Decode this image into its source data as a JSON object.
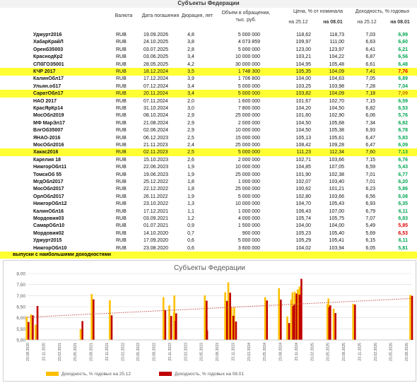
{
  "header": {
    "title": "Субъекты Федерации",
    "col_currency": "Валюта",
    "col_maturity": "Дата погашения",
    "col_duration": "Дюрация, лет",
    "col_volume_1": "Объем в обращении,",
    "col_volume_2": "тыс. руб.",
    "col_price": "Цена, % от номинала",
    "col_price_d1": "на 25.12",
    "col_price_d2": "на 08.01",
    "col_yield": "Доходность, % годовых",
    "col_yield_d1": "на 25.12",
    "col_yield_d2": "на 08.01"
  },
  "colors": {
    "up": "#00a651",
    "down": "#e00000",
    "neutral": "#c07000",
    "highlight": "#ffff33",
    "series1": "#ffc000",
    "series2": "#c00000",
    "trend": "#c0504d"
  },
  "rows": [
    {
      "name": "Удмурт2016",
      "currency": "RUB",
      "maturity": "19.09.2026",
      "duration": "4,8",
      "volume": "5 000 000",
      "price1": "118,62",
      "price2": "118,73",
      "yield1": "7,03",
      "yield2": "6,99",
      "dir": "up",
      "hl": false
    },
    {
      "name": "ХабарКрайЛ",
      "currency": "RUB",
      "maturity": "24.10.2025",
      "duration": "3,8",
      "volume": "4 073 859",
      "price1": "109,97",
      "price2": "111,00",
      "yield1": "6,63",
      "yield2": "6,60",
      "dir": "up",
      "hl": false
    },
    {
      "name": "ОренбЗ5003",
      "currency": "RUB",
      "maturity": "03.07.2025",
      "duration": "2,8",
      "volume": "5 000 000",
      "price1": "123,00",
      "price2": "123,97",
      "yield1": "6,41",
      "yield2": "6,21",
      "dir": "up",
      "hl": false
    },
    {
      "name": "КраснодКр2",
      "currency": "RUB",
      "maturity": "03.06.2025",
      "duration": "3,4",
      "volume": "10 000 000",
      "price1": "103,21",
      "price2": "104,22",
      "yield1": "6,87",
      "yield2": "6,56",
      "dir": "up",
      "hl": false
    },
    {
      "name": "СПбГОЗ5001",
      "currency": "RUB",
      "maturity": "28.05.2025",
      "duration": "4,2",
      "volume": "30 000 000",
      "price1": "104,95",
      "price2": "105,48",
      "yield1": "6,61",
      "yield2": "6,48",
      "dir": "up",
      "hl": false
    },
    {
      "name": "КЧР 2017",
      "currency": "RUB",
      "maturity": "18.12.2024",
      "duration": "3,5",
      "volume": "1 748 300",
      "price1": "105,35",
      "price2": "104,09",
      "yield1": "7,41",
      "yield2": "7,76",
      "dir": "down",
      "hl": true
    },
    {
      "name": "КалинОбл17",
      "currency": "RUB",
      "maturity": "17.12.2024",
      "duration": "3,9",
      "volume": "1 706 800",
      "price1": "104,00",
      "price2": "104,63",
      "yield1": "7,05",
      "yield2": "6,89",
      "dir": "up",
      "hl": false
    },
    {
      "name": "Ульян.об17",
      "currency": "RUB",
      "maturity": "07.12.2024",
      "duration": "3,4",
      "volume": "5 000 000",
      "price1": "103,25",
      "price2": "103,98",
      "yield1": "7,28",
      "yield2": "7,04",
      "dir": "up",
      "hl": false
    },
    {
      "name": "СаратОбл17",
      "currency": "RUB",
      "maturity": "20.11.2024",
      "duration": "3,4",
      "volume": "5 000 000",
      "price1": "103,82",
      "price2": "104,09",
      "yield1": "7,18",
      "yield2": "7,09",
      "dir": "neutral",
      "hl": true
    },
    {
      "name": "НАО 2017",
      "currency": "RUB",
      "maturity": "07.11.2024",
      "duration": "2,0",
      "volume": "1 600 000",
      "price1": "101,67",
      "price2": "102,70",
      "yield1": "7,15",
      "yield2": "6,59",
      "dir": "up",
      "hl": false
    },
    {
      "name": "КрасЯрКр14",
      "currency": "RUB",
      "maturity": "31.10.2024",
      "duration": "3,0",
      "volume": "7 800 000",
      "price1": "104,20",
      "price2": "104,50",
      "yield1": "6,82",
      "yield2": "6,53",
      "dir": "up",
      "hl": false
    },
    {
      "name": "МосОбл2019",
      "currency": "RUB",
      "maturity": "08.10.2024",
      "duration": "2,9",
      "volume": "25 000 000",
      "price1": "101,60",
      "price2": "102,90",
      "yield1": "6,06",
      "yield2": "5,76",
      "dir": "up",
      "hl": false
    },
    {
      "name": "МФ МарЭл17",
      "currency": "RUB",
      "maturity": "21.08.2024",
      "duration": "2,9",
      "volume": "2 000 000",
      "price1": "104,50",
      "price2": "105,68",
      "yield1": "7,34",
      "yield2": "6,82",
      "dir": "up",
      "hl": false
    },
    {
      "name": "ВлгОбЗ5007",
      "currency": "RUB",
      "maturity": "02.06.2024",
      "duration": "2,9",
      "volume": "10 000 000",
      "price1": "104,50",
      "price2": "105,38",
      "yield1": "6,93",
      "yield2": "6,78",
      "dir": "up",
      "hl": false
    },
    {
      "name": "ЯНАО-2016",
      "currency": "RUB",
      "maturity": "06.12.2023",
      "duration": "2,5",
      "volume": "15 000 000",
      "price1": "105,13",
      "price2": "105,61",
      "yield1": "6,47",
      "yield2": "5,83",
      "dir": "up",
      "hl": false
    },
    {
      "name": "МосОбл2016",
      "currency": "RUB",
      "maturity": "21.11.2023",
      "duration": "2,4",
      "volume": "25 000 000",
      "price1": "108,42",
      "price2": "109,28",
      "yield1": "6,47",
      "yield2": "6,09",
      "dir": "up",
      "hl": false
    },
    {
      "name": "Хакас2016",
      "currency": "RUB",
      "maturity": "02.11.2023",
      "duration": "2,5",
      "volume": "5 000 000",
      "price1": "111,23",
      "price2": "112,34",
      "yield1": "7,60",
      "yield2": "7,13",
      "dir": "up",
      "hl": true
    },
    {
      "name": "Карелия 18",
      "currency": "RUB",
      "maturity": "15.10.2023",
      "duration": "2,6",
      "volume": "2 000 000",
      "price1": "102,71",
      "price2": "103,66",
      "yield1": "7,15",
      "yield2": "6,76",
      "dir": "up",
      "hl": false
    },
    {
      "name": "НижгорОбл11",
      "currency": "RUB",
      "maturity": "22.06.2023",
      "duration": "1,9",
      "volume": "10 000 000",
      "price1": "104,85",
      "price2": "107,05",
      "yield1": "6,59",
      "yield2": "5,43",
      "dir": "up",
      "hl": false
    },
    {
      "name": "ТомскОб 55",
      "currency": "RUB",
      "maturity": "19.06.2023",
      "duration": "1,9",
      "volume": "25 000 000",
      "price1": "101,90",
      "price2": "102,38",
      "yield1": "7,01",
      "yield2": "6,77",
      "dir": "up",
      "hl": false
    },
    {
      "name": "МгдОбл2017",
      "currency": "RUB",
      "maturity": "25.12.2022",
      "duration": "1,8",
      "volume": "1 000 000",
      "price1": "102,07",
      "price2": "103,40",
      "yield1": "7,01",
      "yield2": "6,20",
      "dir": "up",
      "hl": false
    },
    {
      "name": "МосОбл2017",
      "currency": "RUB",
      "maturity": "22.12.2022",
      "duration": "1,8",
      "volume": "25 000 000",
      "price1": "100,62",
      "price2": "101,21",
      "yield1": "6,23",
      "yield2": "5,86",
      "dir": "up",
      "hl": false
    },
    {
      "name": "ОрлОбл2017",
      "currency": "RUB",
      "maturity": "26.11.2022",
      "duration": "1,9",
      "volume": "5 000 000",
      "price1": "102,80",
      "price2": "103,66",
      "yield1": "6,56",
      "yield2": "6,08",
      "dir": "up",
      "hl": false
    },
    {
      "name": "НижгорОбл12",
      "currency": "RUB",
      "maturity": "23.10.2022",
      "duration": "1,3",
      "volume": "10 000 000",
      "price1": "104,70",
      "price2": "105,43",
      "yield1": "6,93",
      "yield2": "6,35",
      "dir": "up",
      "hl": false
    },
    {
      "name": "КалинОбл16",
      "currency": "RUB",
      "maturity": "17.12.2021",
      "duration": "1,1",
      "volume": "1 000 000",
      "price1": "106,43",
      "price2": "107,00",
      "yield1": "6,79",
      "yield2": "6,11",
      "dir": "up",
      "hl": false
    },
    {
      "name": "Мордовия03",
      "currency": "RUB",
      "maturity": "03.09.2021",
      "duration": "1,2",
      "volume": "4 000 000",
      "price1": "105,74",
      "price2": "105,75",
      "yield1": "7,07",
      "yield2": "6,83",
      "dir": "up",
      "hl": false
    },
    {
      "name": "СамарОбл10",
      "currency": "RUB",
      "maturity": "01.07.2021",
      "duration": "0,9",
      "volume": "1 500 000",
      "price1": "104,00",
      "price2": "104,00",
      "yield1": "5,49",
      "yield2": "5,85",
      "dir": "down",
      "hl": false
    },
    {
      "name": "Мордовия02",
      "currency": "RUB",
      "maturity": "14.10.2020",
      "duration": "0,7",
      "volume": "900 000",
      "price1": "105,23",
      "price2": "105,40",
      "yield1": "5,69",
      "yield2": "6,53",
      "dir": "down",
      "hl": false
    },
    {
      "name": "Удмурт2015",
      "currency": "RUB",
      "maturity": "17.09.2020",
      "duration": "0,6",
      "volume": "5 000 000",
      "price1": "105,29",
      "price2": "105,41",
      "yield1": "6,15",
      "yield2": "6,11",
      "dir": "up",
      "hl": false
    },
    {
      "name": "НижгорОбл10",
      "currency": "RUB",
      "maturity": "23.08.2020",
      "duration": "0,6",
      "volume": "3 600 000",
      "price1": "104,02",
      "price2": "103,94",
      "yield1": "6,05",
      "yield2": "5,81",
      "dir": "up",
      "hl": false
    }
  ],
  "note": "выпуски с наибольшими доходностями",
  "chart_data": {
    "type": "bar",
    "title": "Субъекты Федерации",
    "ylim": [
      5.0,
      8.0
    ],
    "yticks": [
      "5,00",
      "5,50",
      "6,00",
      "6,50",
      "7,00",
      "7,50",
      "8,00"
    ],
    "xticks": [
      "23.08.2020",
      "23.11.2020",
      "23.02.2021",
      "23.05.2021",
      "23.08.2021",
      "23.11.2021",
      "23.02.2022",
      "23.05.2022",
      "23.08.2022",
      "23.11.2022",
      "23.02.2023",
      "23.05.2023",
      "23.08.2023",
      "23.11.2023",
      "23.02.2024",
      "23.05.2024",
      "23.08.2024",
      "23.11.2024",
      "23.02.2025",
      "23.05.2025",
      "23.08.2025",
      "23.11.2025",
      "23.02.2026",
      "23.05.2026",
      "23.08.2026"
    ],
    "x_start": "2020-08-23",
    "x_end": "2026-09-20",
    "series": [
      {
        "name": "Доходность, % годовых на 25.12",
        "color": "#ffc000"
      },
      {
        "name": "Доходность, % годовых на 08.01",
        "color": "#c00000"
      }
    ],
    "points": [
      {
        "date": "2026-09-19",
        "y1": 7.03,
        "y2": 6.99
      },
      {
        "date": "2025-10-24",
        "y1": 6.63,
        "y2": 6.6
      },
      {
        "date": "2025-07-03",
        "y1": 6.41,
        "y2": 6.21
      },
      {
        "date": "2025-06-03",
        "y1": 6.87,
        "y2": 6.56
      },
      {
        "date": "2025-05-28",
        "y1": 6.61,
        "y2": 6.48
      },
      {
        "date": "2024-12-18",
        "y1": 7.41,
        "y2": 7.76
      },
      {
        "date": "2024-12-17",
        "y1": 7.05,
        "y2": 6.89
      },
      {
        "date": "2024-12-07",
        "y1": 7.28,
        "y2": 7.04
      },
      {
        "date": "2024-11-20",
        "y1": 7.18,
        "y2": 7.09
      },
      {
        "date": "2024-11-07",
        "y1": 7.15,
        "y2": 6.59
      },
      {
        "date": "2024-10-31",
        "y1": 6.82,
        "y2": 6.53
      },
      {
        "date": "2024-10-08",
        "y1": 6.06,
        "y2": 5.76
      },
      {
        "date": "2024-08-21",
        "y1": 7.34,
        "y2": 6.82
      },
      {
        "date": "2024-06-02",
        "y1": 6.93,
        "y2": 6.78
      },
      {
        "date": "2023-12-06",
        "y1": 6.47,
        "y2": 5.83
      },
      {
        "date": "2023-11-21",
        "y1": 6.47,
        "y2": 6.09
      },
      {
        "date": "2023-11-02",
        "y1": 7.6,
        "y2": 7.13
      },
      {
        "date": "2023-10-15",
        "y1": 7.15,
        "y2": 6.76
      },
      {
        "date": "2023-06-22",
        "y1": 6.59,
        "y2": 5.43
      },
      {
        "date": "2023-06-19",
        "y1": 7.01,
        "y2": 6.77
      },
      {
        "date": "2022-12-25",
        "y1": 7.01,
        "y2": 6.2
      },
      {
        "date": "2022-12-22",
        "y1": 6.23,
        "y2": 5.86
      },
      {
        "date": "2022-11-26",
        "y1": 6.56,
        "y2": 6.08
      },
      {
        "date": "2022-10-23",
        "y1": 6.93,
        "y2": 6.35
      },
      {
        "date": "2021-12-17",
        "y1": 6.79,
        "y2": 6.11
      },
      {
        "date": "2021-09-03",
        "y1": 7.07,
        "y2": 6.83
      },
      {
        "date": "2021-07-01",
        "y1": 5.49,
        "y2": 5.85
      },
      {
        "date": "2020-10-14",
        "y1": 5.69,
        "y2": 6.53
      },
      {
        "date": "2020-09-17",
        "y1": 6.15,
        "y2": 6.11
      },
      {
        "date": "2020-08-23",
        "y1": 6.05,
        "y2": 5.81
      }
    ]
  }
}
